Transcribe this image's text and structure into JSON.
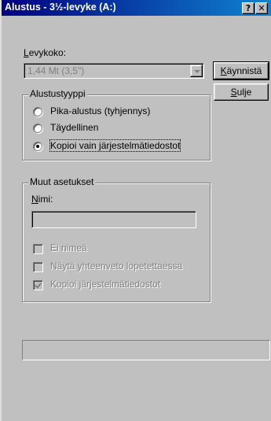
{
  "window": {
    "title": "Alustus - 3½-levyke (A:)",
    "help_glyph": "?",
    "close_glyph": "✕"
  },
  "capacity": {
    "label": "Levykoko:",
    "value": "1,44 Mt (3,5\")"
  },
  "buttons": {
    "start": "Käynnistä",
    "close": "Sulje"
  },
  "format_type": {
    "legend": "Alustustyyppi",
    "options": [
      {
        "label": "Pika-alustus (tyhjennys)",
        "selected": false
      },
      {
        "label": "Täydellinen",
        "selected": false
      },
      {
        "label": "Kopioi vain järjestelmätiedostot",
        "selected": true
      }
    ]
  },
  "other_settings": {
    "legend": "Muut asetukset",
    "name_label": "Nimi:",
    "name_value": "",
    "checkboxes": [
      {
        "label": "Ei nimeä",
        "checked": false
      },
      {
        "label": "Näytä yhteenveto lopetettaessa",
        "checked": false
      },
      {
        "label": "Kopioi järjestelmätiedostot",
        "checked": true
      }
    ]
  },
  "colors": {
    "titlebar": "#000080",
    "dialog_face": "#c0c0c0",
    "desktop": "#fffbd0",
    "disabled_text": "#808080"
  }
}
